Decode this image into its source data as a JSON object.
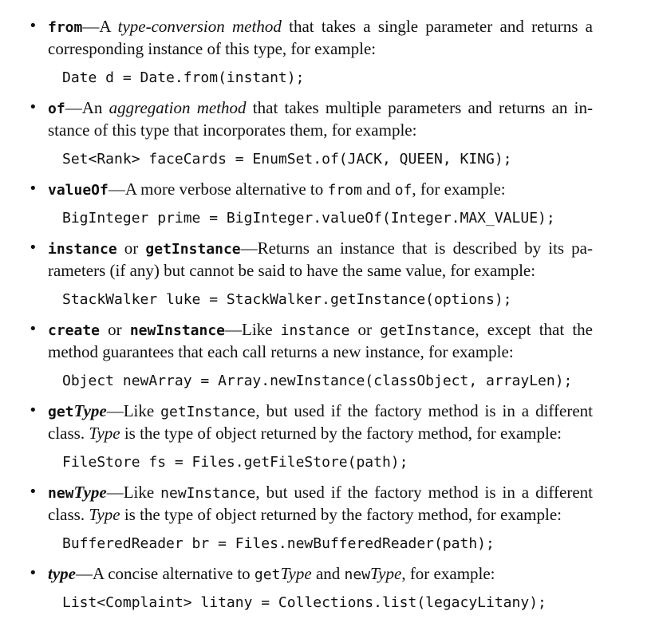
{
  "items": [
    {
      "term": "from",
      "dash": "—",
      "line1_a": "A ",
      "line1_em": "type-conversion method",
      "line1_b": " that takes a single parameter and returns a",
      "line2": "corresponding instance of this type, for example:",
      "code": "Date d = Date.from(instant);"
    },
    {
      "term": "of",
      "dash": "—",
      "line1_a": "An ",
      "line1_em": "aggregation method",
      "line1_b": " that takes multiple parameters and returns an in-",
      "line2": "stance of this type that incorporates them, for example:",
      "code": "Set<Rank> faceCards = EnumSet.of(JACK, QUEEN, KING);"
    },
    {
      "term": "valueOf",
      "dash": "—",
      "line1_a": "A more verbose alternative to ",
      "line1_code1": "from",
      "line1_and": " and ",
      "line1_code2": "of",
      "line1_b": ", for example:",
      "code": "BigInteger prime = BigInteger.valueOf(Integer.MAX_VALUE);"
    },
    {
      "term": "instance",
      "or": " or ",
      "term2": "getInstance",
      "dash": "—",
      "line1_b": "Returns an instance that is described by its pa-",
      "line2": "rameters (if any) but cannot be said to have the same value, for example:",
      "code": "StackWalker luke = StackWalker.getInstance(options);"
    },
    {
      "term": "create",
      "or": " or ",
      "term2": "newInstance",
      "dash": "—",
      "line1_a": "Like ",
      "line1_code1": "instance",
      "line1_or": " or ",
      "line1_code2": "getInstance",
      "line1_b": ", except that the",
      "line2": "method guarantees that each call returns a new instance, for example:",
      "code": "Object newArray = Array.newInstance(classObject, arrayLen);"
    },
    {
      "term_mono": "get",
      "term_it": "Type",
      "dash": "—",
      "line1_a": "Like ",
      "line1_code1": "getInstance",
      "line1_b": ", but used if the factory method is in a different",
      "line2_a": "class. ",
      "line2_em": "Type",
      "line2_b": " is the type of object returned by the factory method, for example:",
      "code": "FileStore fs = Files.getFileStore(path);"
    },
    {
      "term_mono": "new",
      "term_it": "Type",
      "dash": "—",
      "line1_a": "Like ",
      "line1_code1": "newInstance",
      "line1_b": ", but used if the factory method is in a different",
      "line2_a": "class. ",
      "line2_em": "Type",
      "line2_b": " is the type of object returned by the factory method, for example:",
      "code": "BufferedReader br = Files.newBufferedReader(path);"
    },
    {
      "term_it": "type",
      "dash": "—",
      "line1_a": "A concise alternative to ",
      "line1_code1": "get",
      "line1_em1": "Type",
      "line1_and": " and ",
      "line1_code2": "new",
      "line1_em2": "Type",
      "line1_b": ", for example:",
      "code": "List<Complaint> litany = Collections.list(legacyLitany);"
    }
  ],
  "bullet_glyph": "•"
}
